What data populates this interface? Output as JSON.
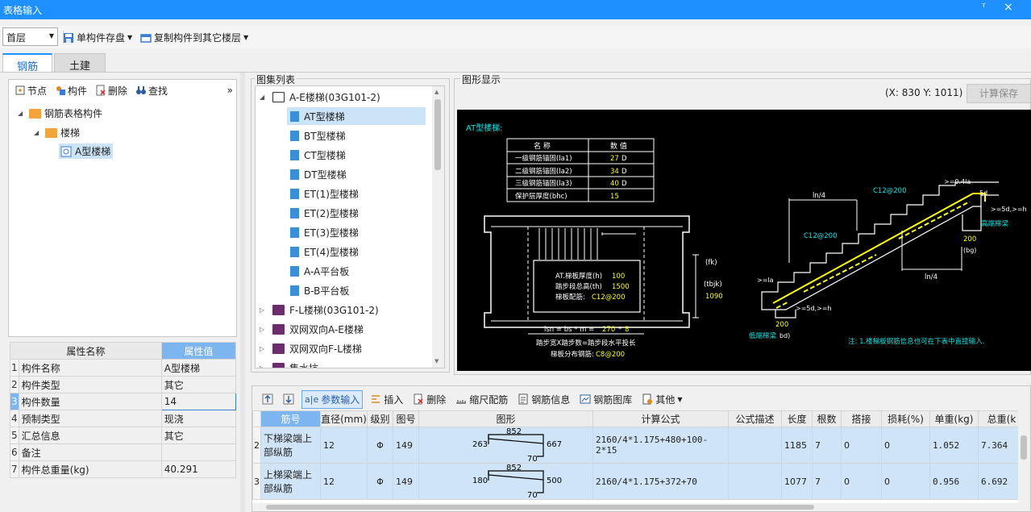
{
  "window": {
    "title": "表格输入",
    "pin": "ᵀ",
    "close": "×"
  },
  "toolbar": {
    "floor": "首层",
    "save_single": "单构件存盘",
    "copy_to_floor": "复制构件到其它楼层"
  },
  "tabs": [
    {
      "label": "钢筋"
    },
    {
      "label": "土建"
    }
  ],
  "left_toolbar": {
    "node": "节点",
    "component": "构件",
    "delete": "删除",
    "find": "查找",
    "more": "»"
  },
  "tree": {
    "root": "钢筋表格构件",
    "child": "楼梯",
    "leaf": "A型楼梯"
  },
  "props": {
    "header_name": "属性名称",
    "header_value": "属性值",
    "rows": [
      {
        "idx": "1",
        "name": "构件名称",
        "value": "A型楼梯"
      },
      {
        "idx": "2",
        "name": "构件类型",
        "value": "其它"
      },
      {
        "idx": "3",
        "name": "构件数量",
        "value": "14"
      },
      {
        "idx": "4",
        "name": "预制类型",
        "value": "现浇"
      },
      {
        "idx": "5",
        "name": "汇总信息",
        "value": "其它"
      },
      {
        "idx": "6",
        "name": "备注",
        "value": ""
      },
      {
        "idx": "7",
        "name": "构件总重量(kg)",
        "value": "40.291"
      }
    ]
  },
  "atlas": {
    "title": "图集列表",
    "group1": "A-E楼梯(03G101-2)",
    "items": [
      "AT型楼梯",
      "BT型楼梯",
      "CT型楼梯",
      "DT型楼梯",
      "ET(1)型楼梯",
      "ET(2)型楼梯",
      "ET(3)型楼梯",
      "ET(4)型楼梯",
      "A-A平台板",
      "B-B平台板"
    ],
    "groups": [
      "F-L楼梯(03G101-2)",
      "双网双向A-E楼梯",
      "双网双向F-L楼梯",
      "集水坑"
    ]
  },
  "graphic": {
    "title": "图形显示",
    "coords": "(X: 830 Y: 1011)",
    "calc_save": "计算保存",
    "drawing": {
      "heading": "AT型楼梯:",
      "table_header": [
        "名  称",
        "数  值"
      ],
      "table_rows": [
        [
          "一级钢筋锚固(la1)",
          "27",
          "D"
        ],
        [
          "二级钢筋锚固(la2)",
          "34",
          "D"
        ],
        [
          "三级钢筋锚固(la3)",
          "40",
          "D"
        ],
        [
          "保护层厚度(bhc)",
          "15",
          ""
        ]
      ],
      "plan_labels": {
        "thick": "AT.梯板厚度(h)",
        "thick_val": "100",
        "rise": "踏步段总高(th)",
        "rise_val": "1500",
        "rebar": "梯板配筋:",
        "rebar_val": "C12@200",
        "fk": "(fk)",
        "tbjk": "(tbjk)",
        "tbjk_val": "1090",
        "lsn": "lsn = bs * m =",
        "lsn_val1": "270",
        "lsn_val2": "8",
        "lsn_desc": "踏步宽X踏步数=踏步段水平投长",
        "dist": "梯板分布钢筋:",
        "dist_val": "C8@200"
      },
      "section_labels": {
        "ln4a": "ln/4",
        "ln4b": "ln/4",
        "c12a": "C12@200",
        "c12b": "C12@200",
        "c04": ">=0.4la",
        "c5d": "5d",
        "c5dh": ">=5d,>=h",
        "high_beam": "高端梯梁",
        "v200a": "200",
        "bg": "(bg)",
        "la": ">=la",
        "c5dh2": ">=5d,>=h",
        "v200b": "200",
        "low_beam": "低端梯梁",
        "bd": "bd)",
        "note": "注: 1.楼梯板钢筋信息也可在下表中直接输入."
      }
    }
  },
  "bottom_toolbar": {
    "param_input": "参数输入",
    "insert": "插入",
    "delete": "删除",
    "scale": "缩尺配筋",
    "rebar_info": "钢筋信息",
    "rebar_lib": "钢筋图库",
    "other": "其他"
  },
  "grid": {
    "headers": [
      "筋号",
      "直径(mm)",
      "级别",
      "图号",
      "图形",
      "计算公式",
      "公式描述",
      "长度",
      "根数",
      "搭接",
      "损耗(%)",
      "单重(kg)",
      "总重(k"
    ],
    "rows": [
      {
        "idx": "2",
        "name": "下梯梁端上部纵筋",
        "dia": "12",
        "grade": "Φ",
        "fig": "149",
        "shape": {
          "top": "852",
          "left": "263",
          "right": "667",
          "bottom": "70"
        },
        "formula": "2160/4*1.175+480+100-2*15",
        "desc": "",
        "length": "1185",
        "count": "7",
        "lap": "0",
        "loss": "0",
        "unit_w": "1.052",
        "total_w": "7.364"
      },
      {
        "idx": "3",
        "name": "上梯梁端上部纵筋",
        "dia": "12",
        "grade": "Φ",
        "fig": "149",
        "shape": {
          "top": "852",
          "left": "180",
          "right": "500",
          "bottom": "70"
        },
        "formula": "2160/4*1.175+372+70",
        "desc": "",
        "length": "1077",
        "count": "7",
        "lap": "0",
        "loss": "0",
        "unit_w": "0.956",
        "total_w": "6.692"
      }
    ]
  },
  "colors": {
    "accent": "#1e90ff",
    "selected": "#cfe4f7",
    "header_value": "#7db5f0",
    "cad_yellow": "#ffff00",
    "cad_cyan": "#00e5e5",
    "cad_white": "#ffffff"
  }
}
